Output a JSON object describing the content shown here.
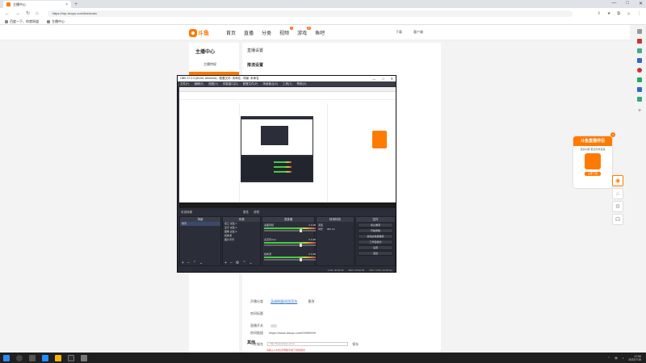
{
  "browser": {
    "tab_title": "主播中心",
    "url": "https://mp.douyu.com/live/main",
    "bookmarks": [
      "百度一下，你就知道",
      "主播中心"
    ]
  },
  "site": {
    "logo_text": "斗鱼",
    "nav": [
      {
        "label": "首页",
        "badge": ""
      },
      {
        "label": "直播",
        "badge": ""
      },
      {
        "label": "分类",
        "badge": ""
      },
      {
        "label": "视频",
        "badge": "6"
      },
      {
        "label": "游戏",
        "badge": "新"
      },
      {
        "label": "鱼吧",
        "badge": ""
      }
    ],
    "header_right": [
      "下载",
      "客户端"
    ]
  },
  "sidemenu": {
    "title": "主播中心",
    "item": "主播特权"
  },
  "content": {
    "heading": "直播设置",
    "section": "推流设置",
    "fields": [
      {
        "label": "开播分类",
        "link": "英雄联盟/网游竞技",
        "extra": "更改"
      },
      {
        "label": "房间标题",
        "link": "",
        "extra": ""
      },
      {
        "label": "直播开关",
        "link": "",
        "extra": ""
      }
    ],
    "other_section": "其他",
    "room_link_label": "房间链接",
    "room_link": "https://www.douyu.com/9999999",
    "custom_label": "个性域名",
    "custom_placeholder": "http://www.douyu.com/",
    "custom_btn": "保存",
    "warning": "请输入2-30位字母数字或下划线组合"
  },
  "promo": {
    "title": "斗鱼直播伴侣",
    "sub": "更多功能 更加高效直播",
    "button": "立即下载"
  },
  "obs": {
    "title": "OBS 27.2.4 (64-bit, windows) - 配置文件: 未命名 - 场景: 未命名",
    "menu": [
      "文件(F)",
      "编辑(E)",
      "视图(V)",
      "停靠窗口(D)",
      "配置文件(P)",
      "场景集合(S)",
      "工具(T)",
      "帮助(H)"
    ],
    "dock_toolbar_left": "未选择源",
    "dock_toolbar_mid": [
      "属性",
      "滤镜"
    ],
    "panels": {
      "scenes": {
        "title": "场景",
        "items": [
          "场景"
        ]
      },
      "sources": {
        "title": "来源",
        "items": [
          "窗口 采集 1",
          "显示 采集 2",
          "图像 采集 3",
          "媒体源",
          "图片背景"
        ]
      },
      "mixer": {
        "title": "混音器",
        "rows": [
          {
            "name": "桌面音频",
            "db": "0.0 dB"
          },
          {
            "name": "麦克风/Aux",
            "db": "0.0 dB"
          },
          {
            "name": "媒体源",
            "db": "0.0 dB"
          }
        ]
      },
      "transitions": {
        "title": "转场特效",
        "type": "渐变",
        "duration_label": "时长",
        "duration": "300 ms"
      },
      "controls": {
        "title": "控件",
        "buttons": [
          "停止推流",
          "开始录制",
          "启动虚拟摄像机",
          "工作室模式",
          "设置",
          "退出"
        ]
      }
    },
    "status": [
      "LIVE: 00:00:00",
      "REC: 00:00:00",
      "CPU: 0.8%, 30.00 fps"
    ]
  },
  "taskbar": {
    "time": "17:00",
    "date": "2022/7/15"
  },
  "colors": {
    "brand": "#ff7a00",
    "obs_bg": "#2b2e38",
    "link": "#3a7bd5"
  }
}
